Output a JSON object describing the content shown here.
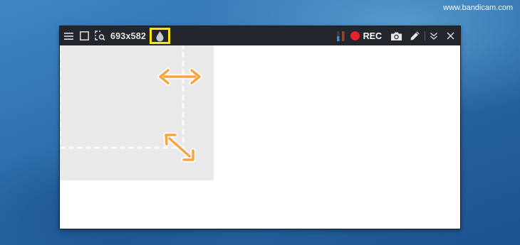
{
  "watermark": "www.bandicam.com",
  "toolbar": {
    "size_label": "693x582",
    "rec_label": "REC",
    "icons": [
      "menu-icon",
      "fullscreen-icon",
      "select-area-icon",
      "water-drop-icon",
      "audio-level-icon",
      "record-icon",
      "camera-icon",
      "pencil-icon",
      "chevron-double-down-icon",
      "close-icon"
    ]
  },
  "colors": {
    "toolbar_bg": "#23272d",
    "highlight": "#ffe600",
    "record_red": "#e8202a",
    "arrow_orange": "#f7a440",
    "area_gray": "#e9e9e9"
  }
}
